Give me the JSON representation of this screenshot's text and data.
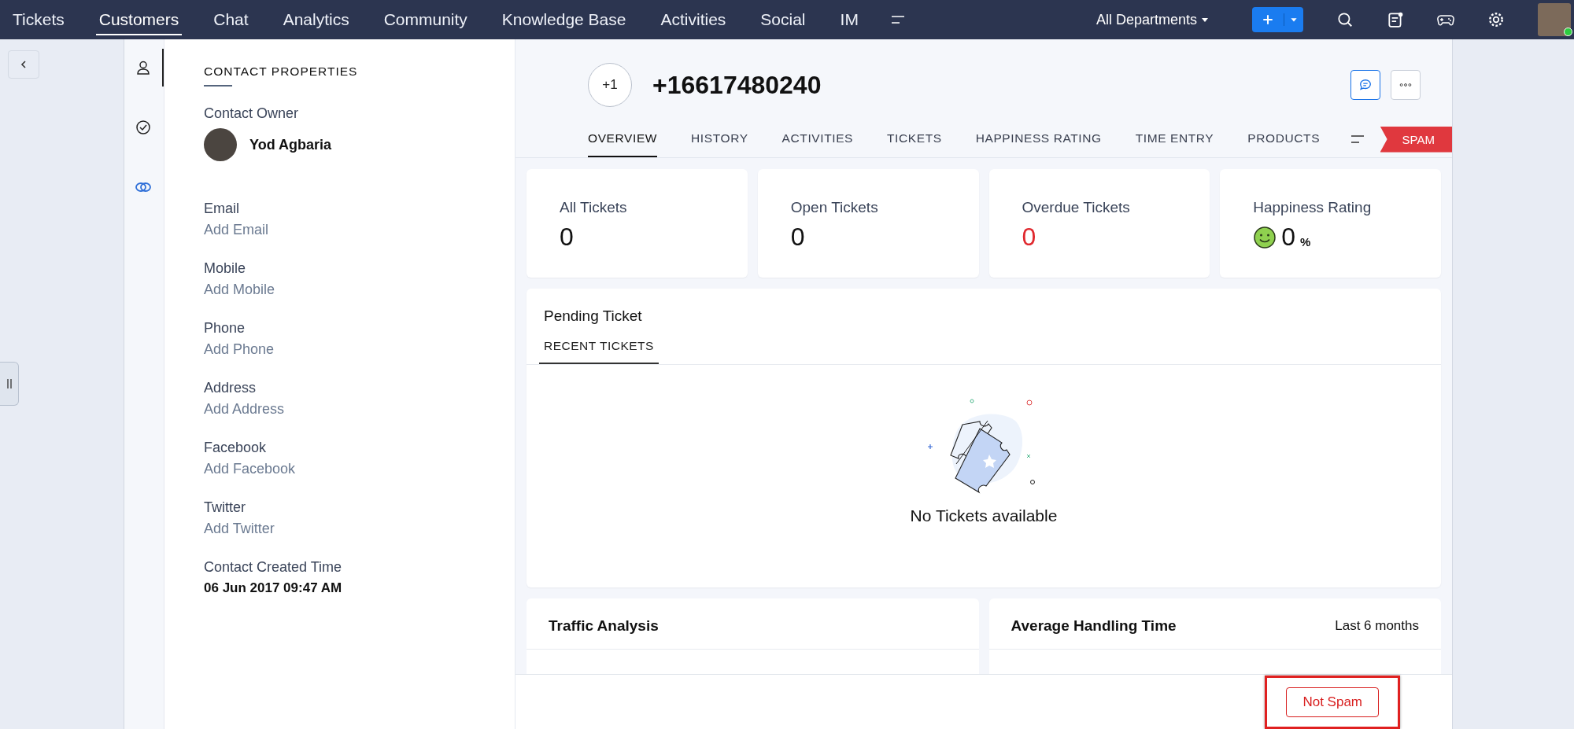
{
  "nav": {
    "items": [
      {
        "label": "Tickets",
        "selected": false
      },
      {
        "label": "Customers",
        "selected": true
      },
      {
        "label": "Chat",
        "selected": false
      },
      {
        "label": "Analytics",
        "selected": false
      },
      {
        "label": "Community",
        "selected": false
      },
      {
        "label": "Knowledge Base",
        "selected": false
      },
      {
        "label": "Activities",
        "selected": false
      },
      {
        "label": "Social",
        "selected": false
      },
      {
        "label": "IM",
        "selected": false
      }
    ],
    "department": "All Departments",
    "user_online": true
  },
  "side_tabs": [
    {
      "kind": "contact",
      "selected": true
    },
    {
      "kind": "tasks",
      "selected": false
    },
    {
      "kind": "link",
      "selected": false
    }
  ],
  "properties": {
    "title": "CONTACT PROPERTIES",
    "owner_label": "Contact Owner",
    "owner_name": "Yod Agbaria",
    "fields": [
      {
        "label": "Email",
        "value": "Add Email",
        "kind": "empty"
      },
      {
        "label": "Mobile",
        "value": "Add Mobile",
        "kind": "empty"
      },
      {
        "label": "Phone",
        "value": "Add Phone",
        "kind": "empty"
      },
      {
        "label": "Address",
        "value": "Add Address",
        "kind": "empty"
      },
      {
        "label": "Facebook",
        "value": "Add Facebook",
        "kind": "empty"
      },
      {
        "label": "Twitter",
        "value": "Add Twitter",
        "kind": "empty"
      },
      {
        "label": "Contact Created Time",
        "value": "06 Jun 2017 09:47 AM",
        "kind": "filled"
      }
    ]
  },
  "contact": {
    "country_code": "+1",
    "phone": "+16617480240",
    "tabs": [
      {
        "label": "OVERVIEW",
        "selected": true
      },
      {
        "label": "HISTORY",
        "selected": false
      },
      {
        "label": "ACTIVITIES",
        "selected": false
      },
      {
        "label": "TICKETS",
        "selected": false
      },
      {
        "label": "HAPPINESS RATING",
        "selected": false
      },
      {
        "label": "TIME ENTRY",
        "selected": false
      },
      {
        "label": "PRODUCTS",
        "selected": false
      }
    ],
    "spam_label": "SPAM"
  },
  "stats": [
    {
      "label": "All Tickets",
      "value": "0",
      "kind": "count"
    },
    {
      "label": "Open Tickets",
      "value": "0",
      "kind": "count"
    },
    {
      "label": "Overdue Tickets",
      "value": "0",
      "kind": "alert"
    },
    {
      "label": "Happiness Rating",
      "value": "0",
      "unit": "%",
      "kind": "rating"
    }
  ],
  "pending": {
    "title": "Pending Ticket",
    "tabs": [
      {
        "label": "RECENT TICKETS",
        "selected": true
      }
    ],
    "empty_message": "No Tickets available"
  },
  "panels": [
    {
      "title": "Traffic Analysis"
    },
    {
      "title": "Average Handling Time",
      "period": "Last 6 months"
    }
  ],
  "footer": {
    "button": "Not Spam",
    "highlighted": true
  }
}
